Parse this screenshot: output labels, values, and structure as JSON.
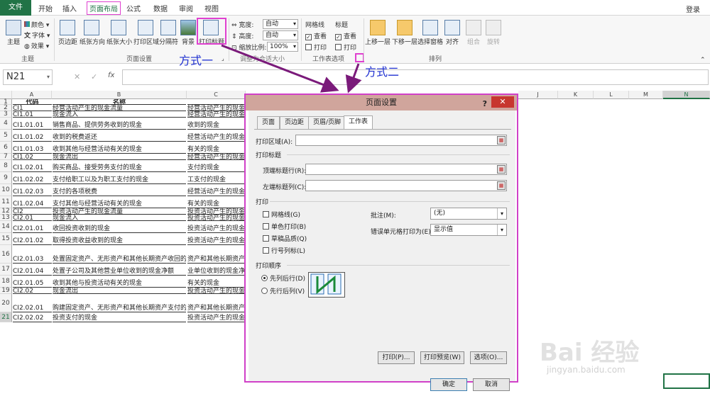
{
  "tabs": {
    "file": "文件",
    "items": [
      "开始",
      "插入",
      "页面布局",
      "公式",
      "数据",
      "审阅",
      "视图"
    ],
    "active": "页面布局",
    "login": "登录"
  },
  "ribbon": {
    "theme_group": {
      "label": "主题",
      "themes": "主题",
      "colors": "颜色",
      "fonts": "字体",
      "effects": "效果"
    },
    "page_setup_group": {
      "label": "页面设置",
      "buttons": [
        "页边距",
        "纸张方向",
        "纸张大小",
        "打印区域",
        "分隔符",
        "背景",
        "打印标题"
      ]
    },
    "scale_group": {
      "label": "调整为合适大小",
      "width_label": "宽度:",
      "width_value": "自动",
      "height_label": "高度:",
      "height_value": "自动",
      "scale_label": "缩放比例:",
      "scale_value": "100%"
    },
    "sheet_options_group": {
      "label": "工作表选项",
      "gridlines": "网格线",
      "headings": "标题",
      "view": "查看",
      "print": "打印"
    },
    "arrange_group": {
      "label": "排列",
      "buttons": [
        "上移一层",
        "下移一层",
        "选择窗格",
        "对齐",
        "组合",
        "旋转"
      ]
    }
  },
  "formula_bar": {
    "name_box": "N21",
    "fx": "fx"
  },
  "columns": [
    "A",
    "B",
    "C",
    "J",
    "K",
    "L",
    "M",
    "N"
  ],
  "rows": [
    {
      "n": "1",
      "a": "代码",
      "b": "名称",
      "c": ""
    },
    {
      "n": "2",
      "a": "CI1",
      "b": "经营活动产生的现金流量",
      "c": "经营活动产生的现金"
    },
    {
      "n": "3",
      "a": "CI1.01",
      "b": "现金流入",
      "c": "经营活动产生的现金"
    },
    {
      "n": "4",
      "a": "CI1.01.01",
      "b": "销售商品、提供劳务收到的现金",
      "c": "收到的现金"
    },
    {
      "n": "5",
      "a": "CI1.01.02",
      "b": "收到的税费返还",
      "c": "经营活动产生的现金"
    },
    {
      "n": "6",
      "a": "CI1.01.03",
      "b": "收到其他与经营活动有关的现金",
      "c": "有关的现金"
    },
    {
      "n": "7",
      "a": "CI1.02",
      "b": "现金流出",
      "c": "经营活动产生的现金"
    },
    {
      "n": "8",
      "a": "CI1.02.01",
      "b": "购买商品、接受劳务支付的现金",
      "c": "支付的现金"
    },
    {
      "n": "9",
      "a": "CI1.02.02",
      "b": "支付给职工以及为职工支付的现金",
      "c": "工支付的现金"
    },
    {
      "n": "10",
      "a": "CI1.02.03",
      "b": "支付的各项税费",
      "c": "经营活动产生的现金"
    },
    {
      "n": "11",
      "a": "CI1.02.04",
      "b": "支付其他与经营活动有关的现金",
      "c": "有关的现金"
    },
    {
      "n": "12",
      "a": "CI2",
      "b": "投资活动产生的现金流量",
      "c": "投资活动产生的现金"
    },
    {
      "n": "13",
      "a": "CI2.01",
      "b": "现金流入",
      "c": "投资活动产生的现金"
    },
    {
      "n": "14",
      "a": "CI2.01.01",
      "b": "收回投资收到的现金",
      "c": "投资活动产生的现金"
    },
    {
      "n": "15",
      "a": "CI2.01.02",
      "b": "取得投资收益收到的现金",
      "c": "投资活动产生的现金"
    },
    {
      "n": "16",
      "a": "CI2.01.03",
      "b": "处置固定资产、无形资产和其他长期资产收回的",
      "c": "资产和其他长期资产"
    },
    {
      "n": "17",
      "a": "CI2.01.04",
      "b": "处置子公司及其他营业单位收到的现金净额",
      "c": "业单位收到的现金净"
    },
    {
      "n": "18",
      "a": "CI2.01.05",
      "b": "收到其他与投资活动有关的现金",
      "c": "有关的现金"
    },
    {
      "n": "19",
      "a": "CI2.02",
      "b": "现金流出",
      "c": "投资活动产生的现金"
    },
    {
      "n": "20",
      "a": "CI2.02.01",
      "b": "购建固定资产、无形资产和其他长期资产支付的",
      "c": "资产和其他长期资产"
    },
    {
      "n": "21",
      "a": "CI2.02.02",
      "b": "投资支付的现金",
      "c": "投资活动产生的现金流量 现金流出 投资支付的现金"
    }
  ],
  "dialog": {
    "title": "页面设置",
    "help": "?",
    "close": "✕",
    "tabs": [
      "页面",
      "页边距",
      "页眉/页脚",
      "工作表"
    ],
    "active_tab": "工作表",
    "print_area_label": "打印区域(A):",
    "print_titles_section": "打印标题",
    "top_rows_label": "顶端标题行(R):",
    "left_cols_label": "左端标题列(C):",
    "print_section": "打印",
    "checkboxes": [
      "网格线(G)",
      "单色打印(B)",
      "草稿品质(Q)",
      "行号列标(L)"
    ],
    "comments_label": "批注(M):",
    "comments_value": "(无)",
    "errors_label": "错误单元格打印为(E):",
    "errors_value": "显示值",
    "order_section": "打印顺序",
    "order_options": [
      "先列后行(D)",
      "先行后列(V)"
    ],
    "buttons": {
      "print": "打印(P)...",
      "preview": "打印预览(W)",
      "options": "选项(O)...",
      "ok": "确定",
      "cancel": "取消"
    }
  },
  "annotations": {
    "method1": "方式一",
    "method2": "方式二"
  },
  "watermark": {
    "brand": "Bai 经验",
    "url": "jingyan.baidu.com"
  },
  "colors": {
    "excel_green": "#217346",
    "highlight_magenta": "#e040d0",
    "arrow_purple": "#7a1a7a",
    "annotation_blue": "#1e2fd0",
    "dialog_title_bg": "#d0a59c",
    "close_red": "#c7372f"
  }
}
